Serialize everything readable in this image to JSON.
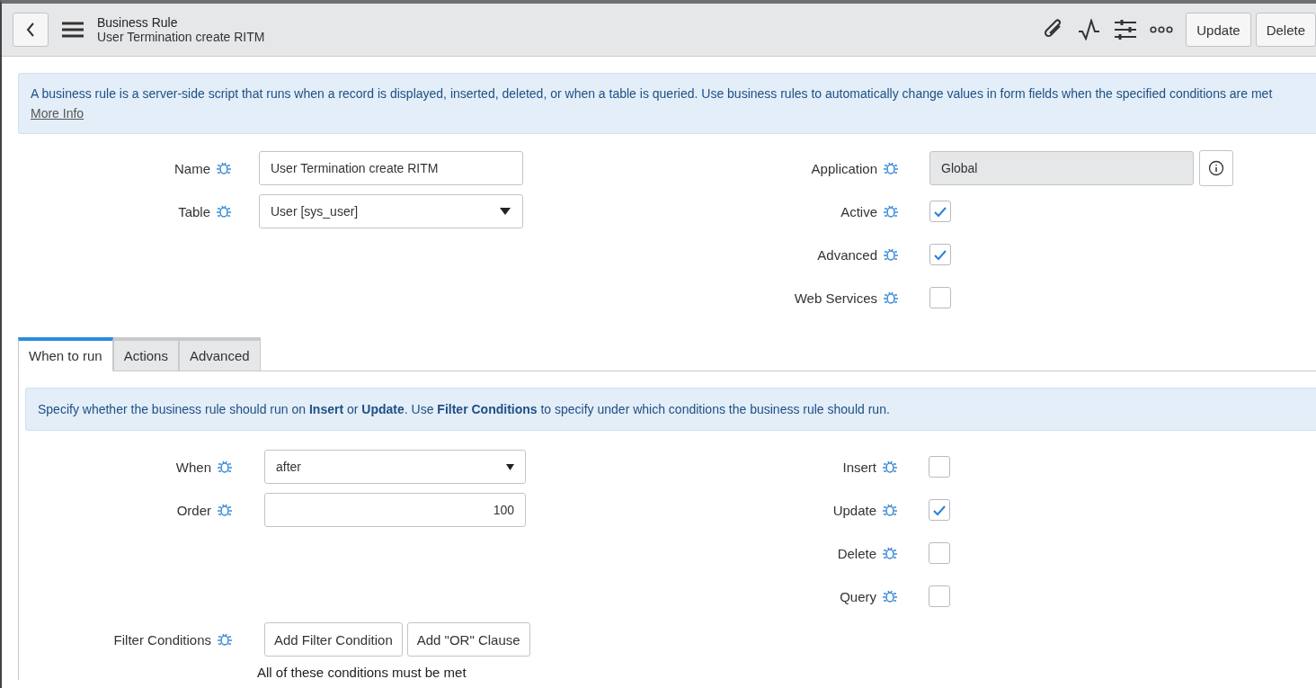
{
  "header": {
    "title": "Business Rule",
    "subtitle": "User Termination create RITM",
    "buttons": [
      "Update",
      "Delete"
    ]
  },
  "info": {
    "text": "A business rule is a server-side script that runs when a record is displayed, inserted, deleted, or when a table is queried. Use business rules to automatically change values in form fields when the specified conditions are met",
    "link": "More Info"
  },
  "fields_left": [
    {
      "label": "Name",
      "kind": "text",
      "value": "User Termination create RITM"
    },
    {
      "label": "Table",
      "kind": "select",
      "value": "User [sys_user]"
    }
  ],
  "fields_right": [
    {
      "label": "Application",
      "kind": "readonly",
      "value": "Global"
    },
    {
      "label": "Active",
      "kind": "checkbox",
      "checked": true
    },
    {
      "label": "Advanced",
      "kind": "checkbox",
      "checked": true
    },
    {
      "label": "Web Services",
      "kind": "checkbox",
      "checked": false
    }
  ],
  "tabs": [
    {
      "label": "When to run",
      "selected": true
    },
    {
      "label": "Actions",
      "selected": false
    },
    {
      "label": "Advanced",
      "selected": false
    }
  ],
  "tab_info": "Specify whether the business rule should run on **Insert** or **Update**. Use **Filter Conditions** to specify under which conditions the business rule should run.",
  "when_left": [
    {
      "label": "When",
      "kind": "dropdown",
      "value": "after"
    },
    {
      "label": "Order",
      "kind": "number",
      "value": "100"
    }
  ],
  "when_right": [
    {
      "label": "Insert",
      "kind": "checkbox",
      "checked": false
    },
    {
      "label": "Update",
      "kind": "checkbox",
      "checked": true
    },
    {
      "label": "Delete",
      "kind": "checkbox",
      "checked": false
    },
    {
      "label": "Query",
      "kind": "checkbox",
      "checked": false
    }
  ],
  "filter": {
    "label": "Filter Conditions",
    "buttons": [
      "Add Filter Condition",
      "Add \"OR\" Clause"
    ],
    "note": "All of these conditions must be met"
  }
}
